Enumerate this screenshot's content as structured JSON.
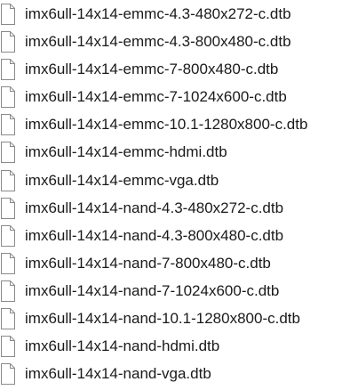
{
  "file_list": {
    "icon": "document-icon",
    "items": [
      {
        "name": "imx6ull-14x14-emmc-4.3-480x272-c.dtb"
      },
      {
        "name": "imx6ull-14x14-emmc-4.3-800x480-c.dtb"
      },
      {
        "name": "imx6ull-14x14-emmc-7-800x480-c.dtb"
      },
      {
        "name": "imx6ull-14x14-emmc-7-1024x600-c.dtb"
      },
      {
        "name": "imx6ull-14x14-emmc-10.1-1280x800-c.dtb"
      },
      {
        "name": "imx6ull-14x14-emmc-hdmi.dtb"
      },
      {
        "name": "imx6ull-14x14-emmc-vga.dtb"
      },
      {
        "name": "imx6ull-14x14-nand-4.3-480x272-c.dtb"
      },
      {
        "name": "imx6ull-14x14-nand-4.3-800x480-c.dtb"
      },
      {
        "name": "imx6ull-14x14-nand-7-800x480-c.dtb"
      },
      {
        "name": "imx6ull-14x14-nand-7-1024x600-c.dtb"
      },
      {
        "name": "imx6ull-14x14-nand-10.1-1280x800-c.dtb"
      },
      {
        "name": "imx6ull-14x14-nand-hdmi.dtb"
      },
      {
        "name": "imx6ull-14x14-nand-vga.dtb"
      }
    ]
  }
}
